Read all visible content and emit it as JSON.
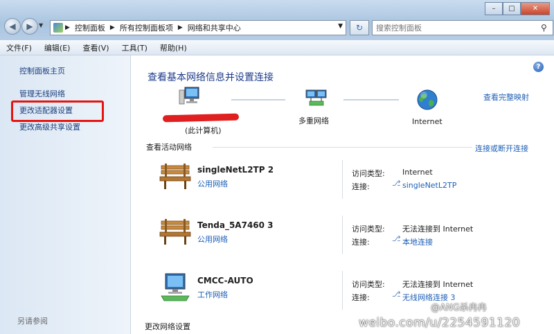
{
  "address": {
    "crumbs": [
      "控制面板",
      "所有控制面板项",
      "网络和共享中心"
    ]
  },
  "search": {
    "placeholder": "搜索控制面板"
  },
  "menu": {
    "items": [
      "文件(F)",
      "编辑(E)",
      "查看(V)",
      "工具(T)",
      "帮助(H)"
    ]
  },
  "sidebar": {
    "items": [
      "控制面板主页",
      "管理无线网络",
      "更改适配器设置",
      "更改高级共享设置"
    ],
    "see_also": "另请参阅"
  },
  "main": {
    "title": "查看基本网络信息并设置连接",
    "view_map": "查看完整映射",
    "map": {
      "computer": "(此计算机)",
      "middle": "多重网络",
      "internet": "Internet"
    },
    "active_head": "查看活动网络",
    "connect_link": "连接或断开连接",
    "access_label": "访问类型:",
    "conn_label": "连接:",
    "networks": [
      {
        "name": "singleNetL2TP  2",
        "type": "公用网络",
        "access": "Internet",
        "conn": "singleNetL2TP"
      },
      {
        "name": "Tenda_5A7460  3",
        "type": "公用网络",
        "access": "无法连接到 Internet",
        "conn": "本地连接"
      },
      {
        "name": "CMCC-AUTO",
        "type": "工作网络",
        "access": "无法连接到 Internet",
        "conn": "无线网络连接 3"
      }
    ],
    "change_head": "更改网络设置"
  },
  "watermark": {
    "line1": "@ANG杀冉冉",
    "line2": "weibo.com/u/2254591120"
  },
  "colors": {
    "link": "#1e5fb6",
    "title": "#1e3b8a",
    "highlight": "#e5140f"
  }
}
